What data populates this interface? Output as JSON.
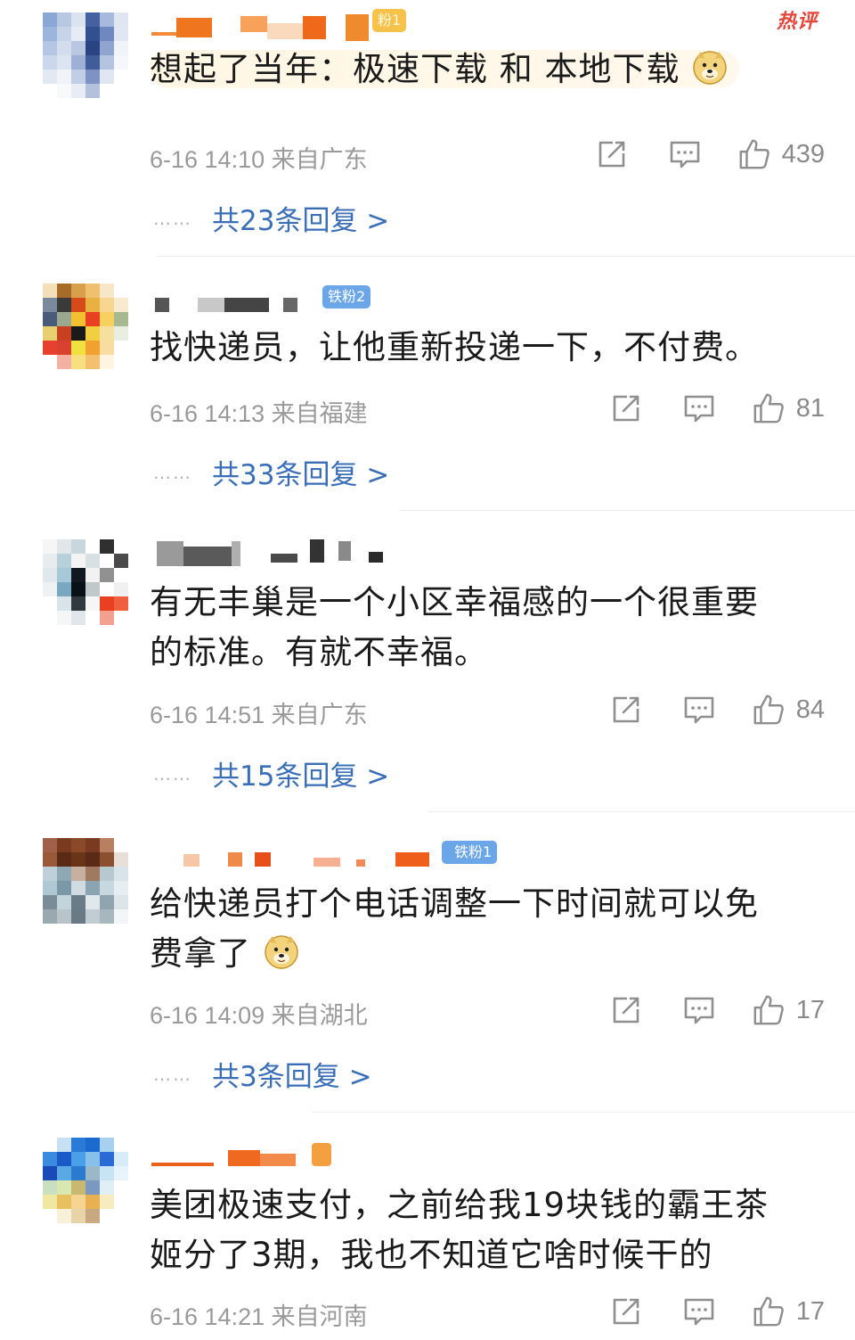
{
  "hot_tag": "热评",
  "comments": [
    {
      "badge": "粉1",
      "text": "想起了当年：极速下载 和 本地下载",
      "date": "6-16 14:10",
      "location": "来自广东",
      "likes": "439",
      "replies": "共23条回复 >"
    },
    {
      "badge": "铁粉2",
      "text": "找快递员，让他重新投递一下，不付费。",
      "date": "6-16 14:13",
      "location": "来自福建",
      "likes": "81",
      "replies": "共33条回复 >"
    },
    {
      "badge": "",
      "text_line1": "有无丰巢是一个小区幸福感的一个很重要",
      "text_line2": "的标准。有就不幸福。",
      "date": "6-16 14:51",
      "location": "来自广东",
      "likes": "84",
      "replies": "共15条回复 >"
    },
    {
      "badge": "铁粉1",
      "text_line1": "给快递员打个电话调整一下时间就可以免",
      "text_line2": "费拿了",
      "date": "6-16 14:09",
      "location": "来自湖北",
      "likes": "17",
      "replies": "共3条回复 >"
    },
    {
      "badge": "",
      "text_line1": "美团极速支付，之前给我19块钱的霸王茶",
      "text_line2": "姬分了3期，我也不知道它啥时候干的",
      "date": "6-16 14:21",
      "location": "来自河南",
      "likes": "17"
    }
  ],
  "dots": "……",
  "icons": {
    "share": "share-icon",
    "comment": "comment-icon",
    "like": "thumbs-up-icon",
    "emoji": "doge-emoji-icon"
  },
  "colors": {
    "reply_link": "#3a6fb8",
    "hot_tag": "#e4463a",
    "meta": "#9a9a9a"
  }
}
